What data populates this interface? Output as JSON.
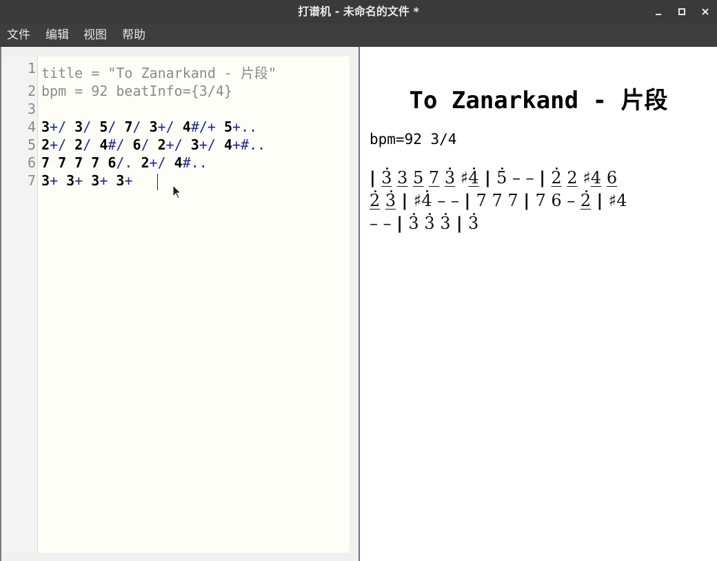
{
  "window": {
    "title": "打谱机 - 未命名的文件 *",
    "minimize_icon": "minimize-icon",
    "maximize_icon": "maximize-icon",
    "close_icon": "close-icon"
  },
  "menu": {
    "items": [
      "文件",
      "编辑",
      "视图",
      "帮助"
    ]
  },
  "editor": {
    "line_numbers": [
      "1",
      "2",
      "3",
      "4",
      "5",
      "6",
      "7"
    ],
    "line1": "title = \"To Zanarkand - 片段\"",
    "line2": "bpm = 92 beatInfo={3/4}",
    "line3": "",
    "line4": [
      {
        "t": "3",
        "c": "note"
      },
      {
        "t": "+/ ",
        "c": "mod"
      },
      {
        "t": "3",
        "c": "note"
      },
      {
        "t": "/ ",
        "c": "mod"
      },
      {
        "t": "5",
        "c": "note"
      },
      {
        "t": "/ ",
        "c": "mod"
      },
      {
        "t": "7",
        "c": "note"
      },
      {
        "t": "/ ",
        "c": "mod"
      },
      {
        "t": "3",
        "c": "note"
      },
      {
        "t": "+/ ",
        "c": "mod"
      },
      {
        "t": "4",
        "c": "note"
      },
      {
        "t": "#/+ ",
        "c": "mod"
      },
      {
        "t": "5",
        "c": "note"
      },
      {
        "t": "+..",
        "c": "mod"
      }
    ],
    "line5": [
      {
        "t": "2",
        "c": "note"
      },
      {
        "t": "+/ ",
        "c": "mod"
      },
      {
        "t": "2",
        "c": "note"
      },
      {
        "t": "/ ",
        "c": "mod"
      },
      {
        "t": "4",
        "c": "note"
      },
      {
        "t": "#/ ",
        "c": "mod"
      },
      {
        "t": "6",
        "c": "note"
      },
      {
        "t": "/ ",
        "c": "mod"
      },
      {
        "t": "2",
        "c": "note"
      },
      {
        "t": "+/ ",
        "c": "mod"
      },
      {
        "t": "3",
        "c": "note"
      },
      {
        "t": "+/ ",
        "c": "mod"
      },
      {
        "t": "4",
        "c": "note"
      },
      {
        "t": "+#..",
        "c": "mod"
      }
    ],
    "line6": [
      {
        "t": "7 7 7 7 6",
        "c": "note"
      },
      {
        "t": "/. ",
        "c": "mod"
      },
      {
        "t": "2",
        "c": "note"
      },
      {
        "t": "+/ ",
        "c": "mod"
      },
      {
        "t": "4",
        "c": "note"
      },
      {
        "t": "#..",
        "c": "mod"
      }
    ],
    "line7": [
      {
        "t": "3",
        "c": "note"
      },
      {
        "t": "+ ",
        "c": "mod"
      },
      {
        "t": "3",
        "c": "note"
      },
      {
        "t": "+ ",
        "c": "mod"
      },
      {
        "t": "3",
        "c": "note"
      },
      {
        "t": "+ ",
        "c": "mod"
      },
      {
        "t": "3",
        "c": "note"
      },
      {
        "t": "+ ",
        "c": "mod"
      }
    ]
  },
  "preview": {
    "title": "To Zanarkand - 片段",
    "info": "bpm=92 3/4",
    "rows": [
      [
        {
          "t": "| ",
          "k": "bar"
        },
        {
          "t": "3",
          "u": true,
          "d": true
        },
        {
          "t": " "
        },
        {
          "t": "3",
          "u": true
        },
        {
          "t": " "
        },
        {
          "t": "5",
          "u": true
        },
        {
          "t": " "
        },
        {
          "t": "7",
          "u": true
        },
        {
          "t": " "
        },
        {
          "t": "3",
          "u": true,
          "d": true
        },
        {
          "t": " "
        },
        {
          "t": "♯"
        },
        {
          "t": "4",
          "u": true,
          "d": true
        },
        {
          "t": " | ",
          "k": "bar"
        },
        {
          "t": "5",
          "d": true
        },
        {
          "t": " – – "
        },
        {
          "t": "| ",
          "k": "bar"
        },
        {
          "t": "2",
          "u": true,
          "d": true
        },
        {
          "t": " "
        },
        {
          "t": "2",
          "u": true
        },
        {
          "t": " "
        },
        {
          "t": "♯"
        },
        {
          "t": "4",
          "u": true
        },
        {
          "t": " "
        },
        {
          "t": "6",
          "u": true
        }
      ],
      [
        {
          "t": "2",
          "u": true,
          "d": true
        },
        {
          "t": " "
        },
        {
          "t": "3",
          "u": true,
          "d": true
        },
        {
          "t": " | ",
          "k": "bar"
        },
        {
          "t": "♯"
        },
        {
          "t": "4",
          "d": true
        },
        {
          "t": " – – "
        },
        {
          "t": "| ",
          "k": "bar"
        },
        {
          "t": "7 7 7 "
        },
        {
          "t": "| ",
          "k": "bar"
        },
        {
          "t": "7 6 – "
        },
        {
          "t": "2",
          "u": true,
          "d": true
        },
        {
          "t": " | ",
          "k": "bar"
        },
        {
          "t": "♯4"
        }
      ],
      [
        {
          "t": "– – "
        },
        {
          "t": "| ",
          "k": "bar"
        },
        {
          "t": "3",
          "d": true
        },
        {
          "t": " "
        },
        {
          "t": "3",
          "d": true
        },
        {
          "t": " "
        },
        {
          "t": "3",
          "d": true
        },
        {
          "t": " | ",
          "k": "bar"
        },
        {
          "t": "3",
          "d": true
        }
      ]
    ]
  },
  "colors": {
    "titlebar": "#3a3a3a",
    "menubar": "#3e3e3e",
    "editor_bg": "#fefef8",
    "modifier": "#1b2a9a",
    "meta": "#8a8a8a",
    "splitter": "#6c708f"
  }
}
